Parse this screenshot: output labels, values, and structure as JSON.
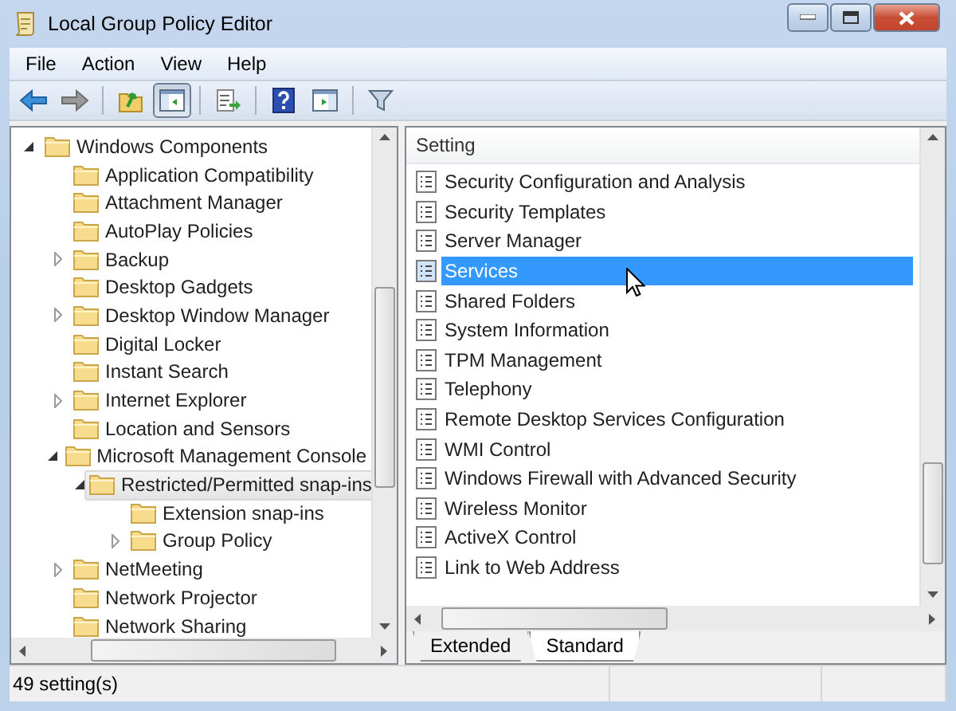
{
  "window": {
    "title": "Local Group Policy Editor"
  },
  "menu": [
    "File",
    "Action",
    "View",
    "Help"
  ],
  "toolbar": [
    {
      "kind": "back",
      "pressed": false
    },
    {
      "kind": "forward",
      "pressed": false
    },
    {
      "kind": "sep"
    },
    {
      "kind": "up",
      "pressed": false
    },
    {
      "kind": "tree",
      "pressed": true
    },
    {
      "kind": "sep"
    },
    {
      "kind": "export",
      "pressed": false
    },
    {
      "kind": "sep"
    },
    {
      "kind": "help",
      "pressed": false
    },
    {
      "kind": "pane",
      "pressed": false
    },
    {
      "kind": "sep"
    },
    {
      "kind": "filter",
      "pressed": false
    }
  ],
  "tree": [
    {
      "label": "Windows Components",
      "expanded": true,
      "selected": false,
      "children": [
        {
          "label": "Application Compatibility",
          "selected": false
        },
        {
          "label": "Attachment Manager",
          "selected": false
        },
        {
          "label": "AutoPlay Policies",
          "selected": false
        },
        {
          "label": "Backup",
          "expanded": false,
          "selected": false
        },
        {
          "label": "Desktop Gadgets",
          "selected": false
        },
        {
          "label": "Desktop Window Manager",
          "expanded": false,
          "selected": false
        },
        {
          "label": "Digital Locker",
          "selected": false
        },
        {
          "label": "Instant Search",
          "selected": false
        },
        {
          "label": "Internet Explorer",
          "expanded": false,
          "selected": false
        },
        {
          "label": "Location and Sensors",
          "selected": false
        },
        {
          "label": "Microsoft Management Console",
          "expanded": true,
          "selected": false,
          "children": [
            {
              "label": "Restricted/Permitted snap-ins",
              "expanded": true,
              "selected": true,
              "children": [
                {
                  "label": "Extension snap-ins",
                  "selected": false
                },
                {
                  "label": "Group Policy",
                  "expanded": false,
                  "selected": false
                }
              ]
            }
          ]
        },
        {
          "label": "NetMeeting",
          "expanded": false,
          "selected": false
        },
        {
          "label": "Network Projector",
          "selected": false
        },
        {
          "label": "Network Sharing",
          "selected": false
        }
      ]
    }
  ],
  "list": {
    "column": "Setting",
    "items": [
      {
        "label": "Security Configuration and Analysis",
        "selected": false
      },
      {
        "label": "Security Templates",
        "selected": false
      },
      {
        "label": "Server Manager",
        "selected": false
      },
      {
        "label": "Services",
        "selected": true
      },
      {
        "label": "Shared Folders",
        "selected": false
      },
      {
        "label": "System Information",
        "selected": false
      },
      {
        "label": "TPM Management",
        "selected": false
      },
      {
        "label": "Telephony",
        "selected": false
      },
      {
        "label": "Remote Desktop Services Configuration",
        "selected": false
      },
      {
        "label": "WMI Control",
        "selected": false
      },
      {
        "label": "Windows Firewall with Advanced Security",
        "selected": false
      },
      {
        "label": "Wireless Monitor",
        "selected": false
      },
      {
        "label": "ActiveX Control",
        "selected": false
      },
      {
        "label": "Link to Web Address",
        "selected": false
      }
    ]
  },
  "tabs": [
    {
      "label": "Extended",
      "selected": false
    },
    {
      "label": "Standard",
      "selected": true
    }
  ],
  "status_bar": {
    "text": "49 setting(s)"
  }
}
